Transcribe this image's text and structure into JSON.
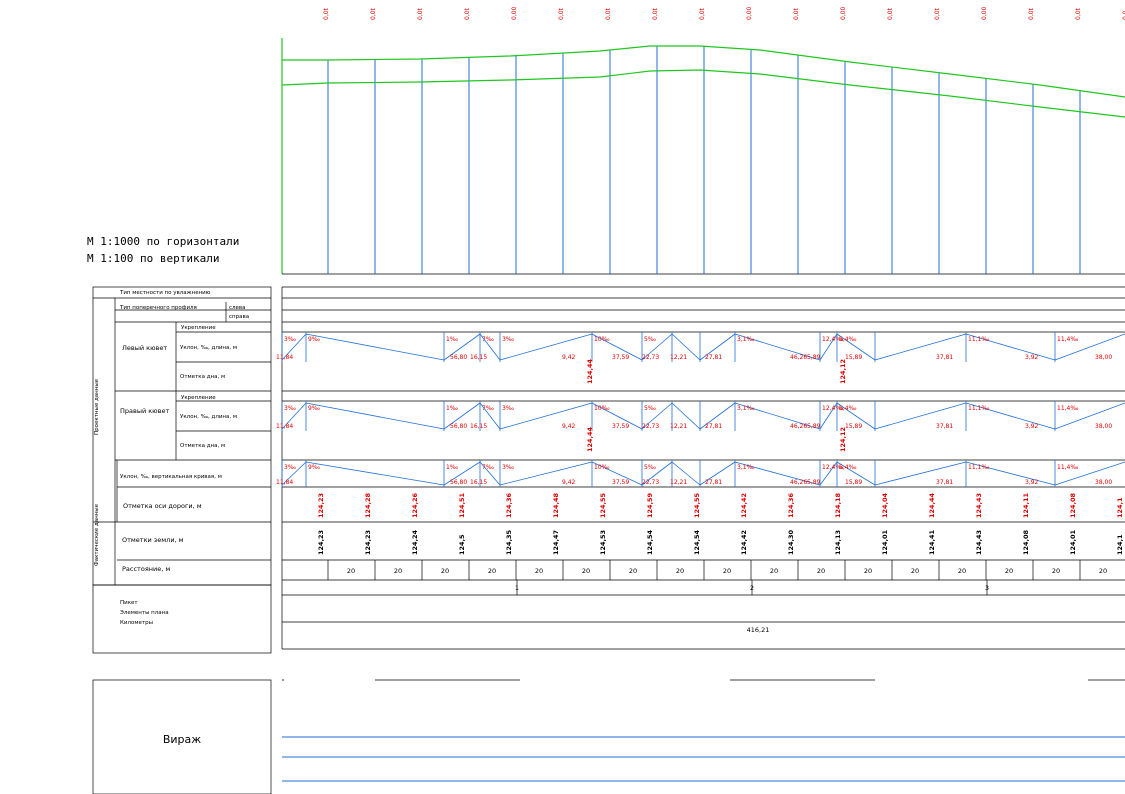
{
  "colors": {
    "profile_line": "#1ec81e",
    "grid_blue": "#1f6fd6",
    "red_text": "#e00000",
    "table_line": "#000000"
  },
  "scale": {
    "horizontal": "М 1:1000 по горизонтали",
    "vertical": "М 1:100 по вертикали"
  },
  "top_marks": [
    "0,0t",
    "0,0t",
    "0,0t",
    "0,0t",
    "0,00",
    "0,0t",
    "0,0t",
    "0,0t",
    "0,0t",
    "0,00",
    "0,0t",
    "0,00",
    "0,0t",
    "0,0t",
    "0,00",
    "0,0t",
    "0,0t",
    "0,0"
  ],
  "rows": {
    "terrain_type": "Тип местности по увлажнению",
    "cross_section": "Тип поперечного профиля",
    "left": "слева",
    "right": "справа",
    "plan_label": "Проектные данные",
    "left_ditch": "Левый кювет",
    "right_ditch": "Правый кювет",
    "reinforcement": "Укрепление",
    "slope_length": "Уклон, ‰, длина, м",
    "bottom_level": "Отметка дна, м",
    "axis_slope": "Уклон, ‰, вертикальная кривая, м",
    "axis_level": "Отметка оси дороги, м",
    "ground_label": "Фактические данные",
    "ground_level": "Отметки земли, м",
    "distance": "Расстояние, м",
    "picket": "Пикет",
    "plan_elements": "Элементы плана",
    "kilometers": "Километры",
    "viraj": "Вираж"
  },
  "slope_entries": [
    {
      "pct": "3‰",
      "len": "11,84"
    },
    {
      "pct": "9‰",
      "len": ""
    },
    {
      "pct": "1‰",
      "len": "56,80"
    },
    {
      "pct": "7‰",
      "len": "16,15"
    },
    {
      "pct": "3‰",
      "len": "9,42"
    },
    {
      "pct": "10‰",
      "len": "37,59"
    },
    {
      "pct": "5‰",
      "len": "22,73"
    },
    {
      "pct": "",
      "len": "12,21"
    },
    {
      "pct": "",
      "len": "27,81"
    },
    {
      "pct": "3,1‰",
      "len": "46,26"
    },
    {
      "pct": "12,4‰",
      "len": "5,89"
    },
    {
      "pct": "6,4‰",
      "len": "15,89"
    },
    {
      "pct": "",
      "len": "37,81"
    },
    {
      "pct": "11,1‰",
      "len": "3,92"
    },
    {
      "pct": "11,4‰",
      "len": "38,00"
    }
  ],
  "bottom_marks": [
    "124,44",
    "124,12"
  ],
  "axis_levels": [
    "124,23",
    "124,28",
    "124,26",
    "124,51",
    "124,36",
    "124,48",
    "124,55",
    "124,59",
    "124,55",
    "124,42",
    "124,36",
    "124,18",
    "124,04",
    "124,44",
    "124,43",
    "124,11",
    "124,08",
    "124,1"
  ],
  "ground_levels": [
    "124,23",
    "124,23",
    "124,24",
    "124,5",
    "124,35",
    "124,47",
    "124,53",
    "124,54",
    "124,54",
    "124,42",
    "124,30",
    "124,13",
    "124,01",
    "124,41",
    "124,43",
    "124,08",
    "124,01",
    "124,1"
  ],
  "distances": [
    "20",
    "20",
    "20",
    "20",
    "20",
    "20",
    "20",
    "20",
    "20",
    "20",
    "20",
    "20",
    "20",
    "20",
    "20",
    "20",
    "20",
    "20"
  ],
  "pickets": [
    "1",
    "2",
    "3"
  ],
  "kilometer_value": "416,21"
}
